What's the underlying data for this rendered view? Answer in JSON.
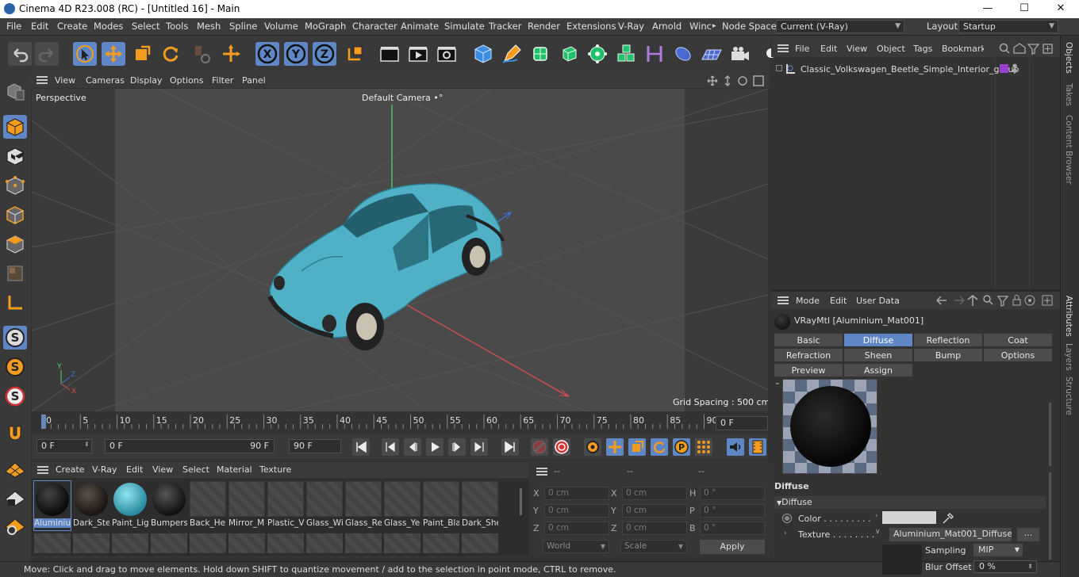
{
  "window": {
    "title": "Cinema 4D R23.008 (RC) - [Untitled 16] - Main",
    "min_glyph": "—",
    "max_glyph": "☐",
    "close_glyph": "✕"
  },
  "menubar": {
    "items": [
      "File",
      "Edit",
      "Create",
      "Modes",
      "Select",
      "Tools",
      "Mesh",
      "Spline",
      "Volume",
      "MoGraph",
      "Character",
      "Animate",
      "Simulate",
      "Tracker",
      "Render",
      "Extensions",
      "V-Ray",
      "Arnold",
      "Winc"
    ],
    "more_glyph": "▸",
    "node_space_label": "Node Space:",
    "node_space_value": "Current (V-Ray)",
    "layout_label": "Layout:",
    "layout_value": "Startup"
  },
  "viewport_menu": {
    "items": [
      "View",
      "Cameras",
      "Display",
      "Options",
      "Filter",
      "Panel"
    ]
  },
  "viewport": {
    "view_name": "Perspective",
    "camera_name": "Default Camera",
    "camera_suffix": "•°",
    "grid_spacing": "Grid Spacing : 500 cm",
    "axis_labels": {
      "y": "Y",
      "z": "Z",
      "x": "X"
    },
    "colors": {
      "car": "#4fb0c6",
      "y_axis": "#4fd06a",
      "x_axis": "#d85050",
      "z_axis": "#3a78d8"
    }
  },
  "timeline": {
    "ticks": [
      "0",
      "5",
      "10",
      "15",
      "20",
      "25",
      "30",
      "35",
      "40",
      "45",
      "50",
      "55",
      "60",
      "65",
      "70",
      "75",
      "80",
      "85",
      "90"
    ],
    "current_frame": "0 F"
  },
  "playback": {
    "start_frame": "0 F",
    "range_start": "0 F",
    "range_end": "90 F",
    "end_frame": "90 F"
  },
  "material_manager": {
    "menu": [
      "Create",
      "V-Ray",
      "Edit",
      "View",
      "Select",
      "Material",
      "Texture"
    ],
    "materials": [
      {
        "name": "Aluminiu",
        "type": "black"
      },
      {
        "name": "Dark_Ste",
        "type": "dark"
      },
      {
        "name": "Paint_Lig",
        "type": "blue"
      },
      {
        "name": "Bumpers",
        "type": "black2"
      },
      {
        "name": "Back_He",
        "type": "empty"
      },
      {
        "name": "Mirror_M",
        "type": "empty"
      },
      {
        "name": "Plastic_V",
        "type": "empty"
      },
      {
        "name": "Glass_Wi",
        "type": "empty"
      },
      {
        "name": "Glass_Re",
        "type": "empty"
      },
      {
        "name": "Glass_Ye",
        "type": "empty"
      },
      {
        "name": "Paint_Bla",
        "type": "empty"
      },
      {
        "name": "Dark_She",
        "type": "empty"
      }
    ]
  },
  "coordinates": {
    "headers": [
      "--",
      "--",
      "--"
    ],
    "rows": [
      {
        "l1": "X",
        "v1": "0 cm",
        "l2": "X",
        "v2": "0 cm",
        "l3": "H",
        "v3": "0 °"
      },
      {
        "l1": "Y",
        "v1": "0 cm",
        "l2": "Y",
        "v2": "0 cm",
        "l3": "P",
        "v3": "0 °"
      },
      {
        "l1": "Z",
        "v1": "0 cm",
        "l2": "Z",
        "v2": "0 cm",
        "l3": "B",
        "v3": "0 °"
      }
    ],
    "world": "World",
    "scale": "Scale",
    "apply": "Apply"
  },
  "status": "Move: Click and drag to move elements. Hold down SHIFT to quantize movement / add to the selection in point mode, CTRL to remove.",
  "objects": {
    "menu": [
      "File",
      "Edit",
      "View",
      "Object",
      "Tags",
      "Bookmarks"
    ],
    "items": [
      {
        "name": "Classic_Volkswagen_Beetle_Simple_Interior_group",
        "tag_color": "#9a3ed0"
      }
    ]
  },
  "side_tabs": [
    "Objects",
    "Takes",
    "Content Browser",
    "Attributes",
    "Layers",
    "Structure"
  ],
  "attributes": {
    "menu": [
      "Mode",
      "Edit",
      "User Data"
    ],
    "material_title": "VRayMtl [Aluminium_Mat001]",
    "tabs_row1": [
      "Basic",
      "Diffuse",
      "Reflection",
      "Coat"
    ],
    "tabs_row2": [
      "Refraction",
      "Sheen",
      "Bump",
      "Options"
    ],
    "tabs_row3": [
      "Preview Settings",
      "Assign"
    ],
    "active_tab": "Diffuse",
    "section": "Diffuse",
    "subsection": "Diffuse",
    "color_label": "Color . . . . . . . . .",
    "texture_label": "Texture . . . . . . . .",
    "texture_value": "Aluminium_Mat001_Diffuse.",
    "more_button": "...",
    "sampling_label": "Sampling",
    "sampling_value": "MIP",
    "blur_label": "Blur Offset",
    "blur_value": "0 %"
  }
}
